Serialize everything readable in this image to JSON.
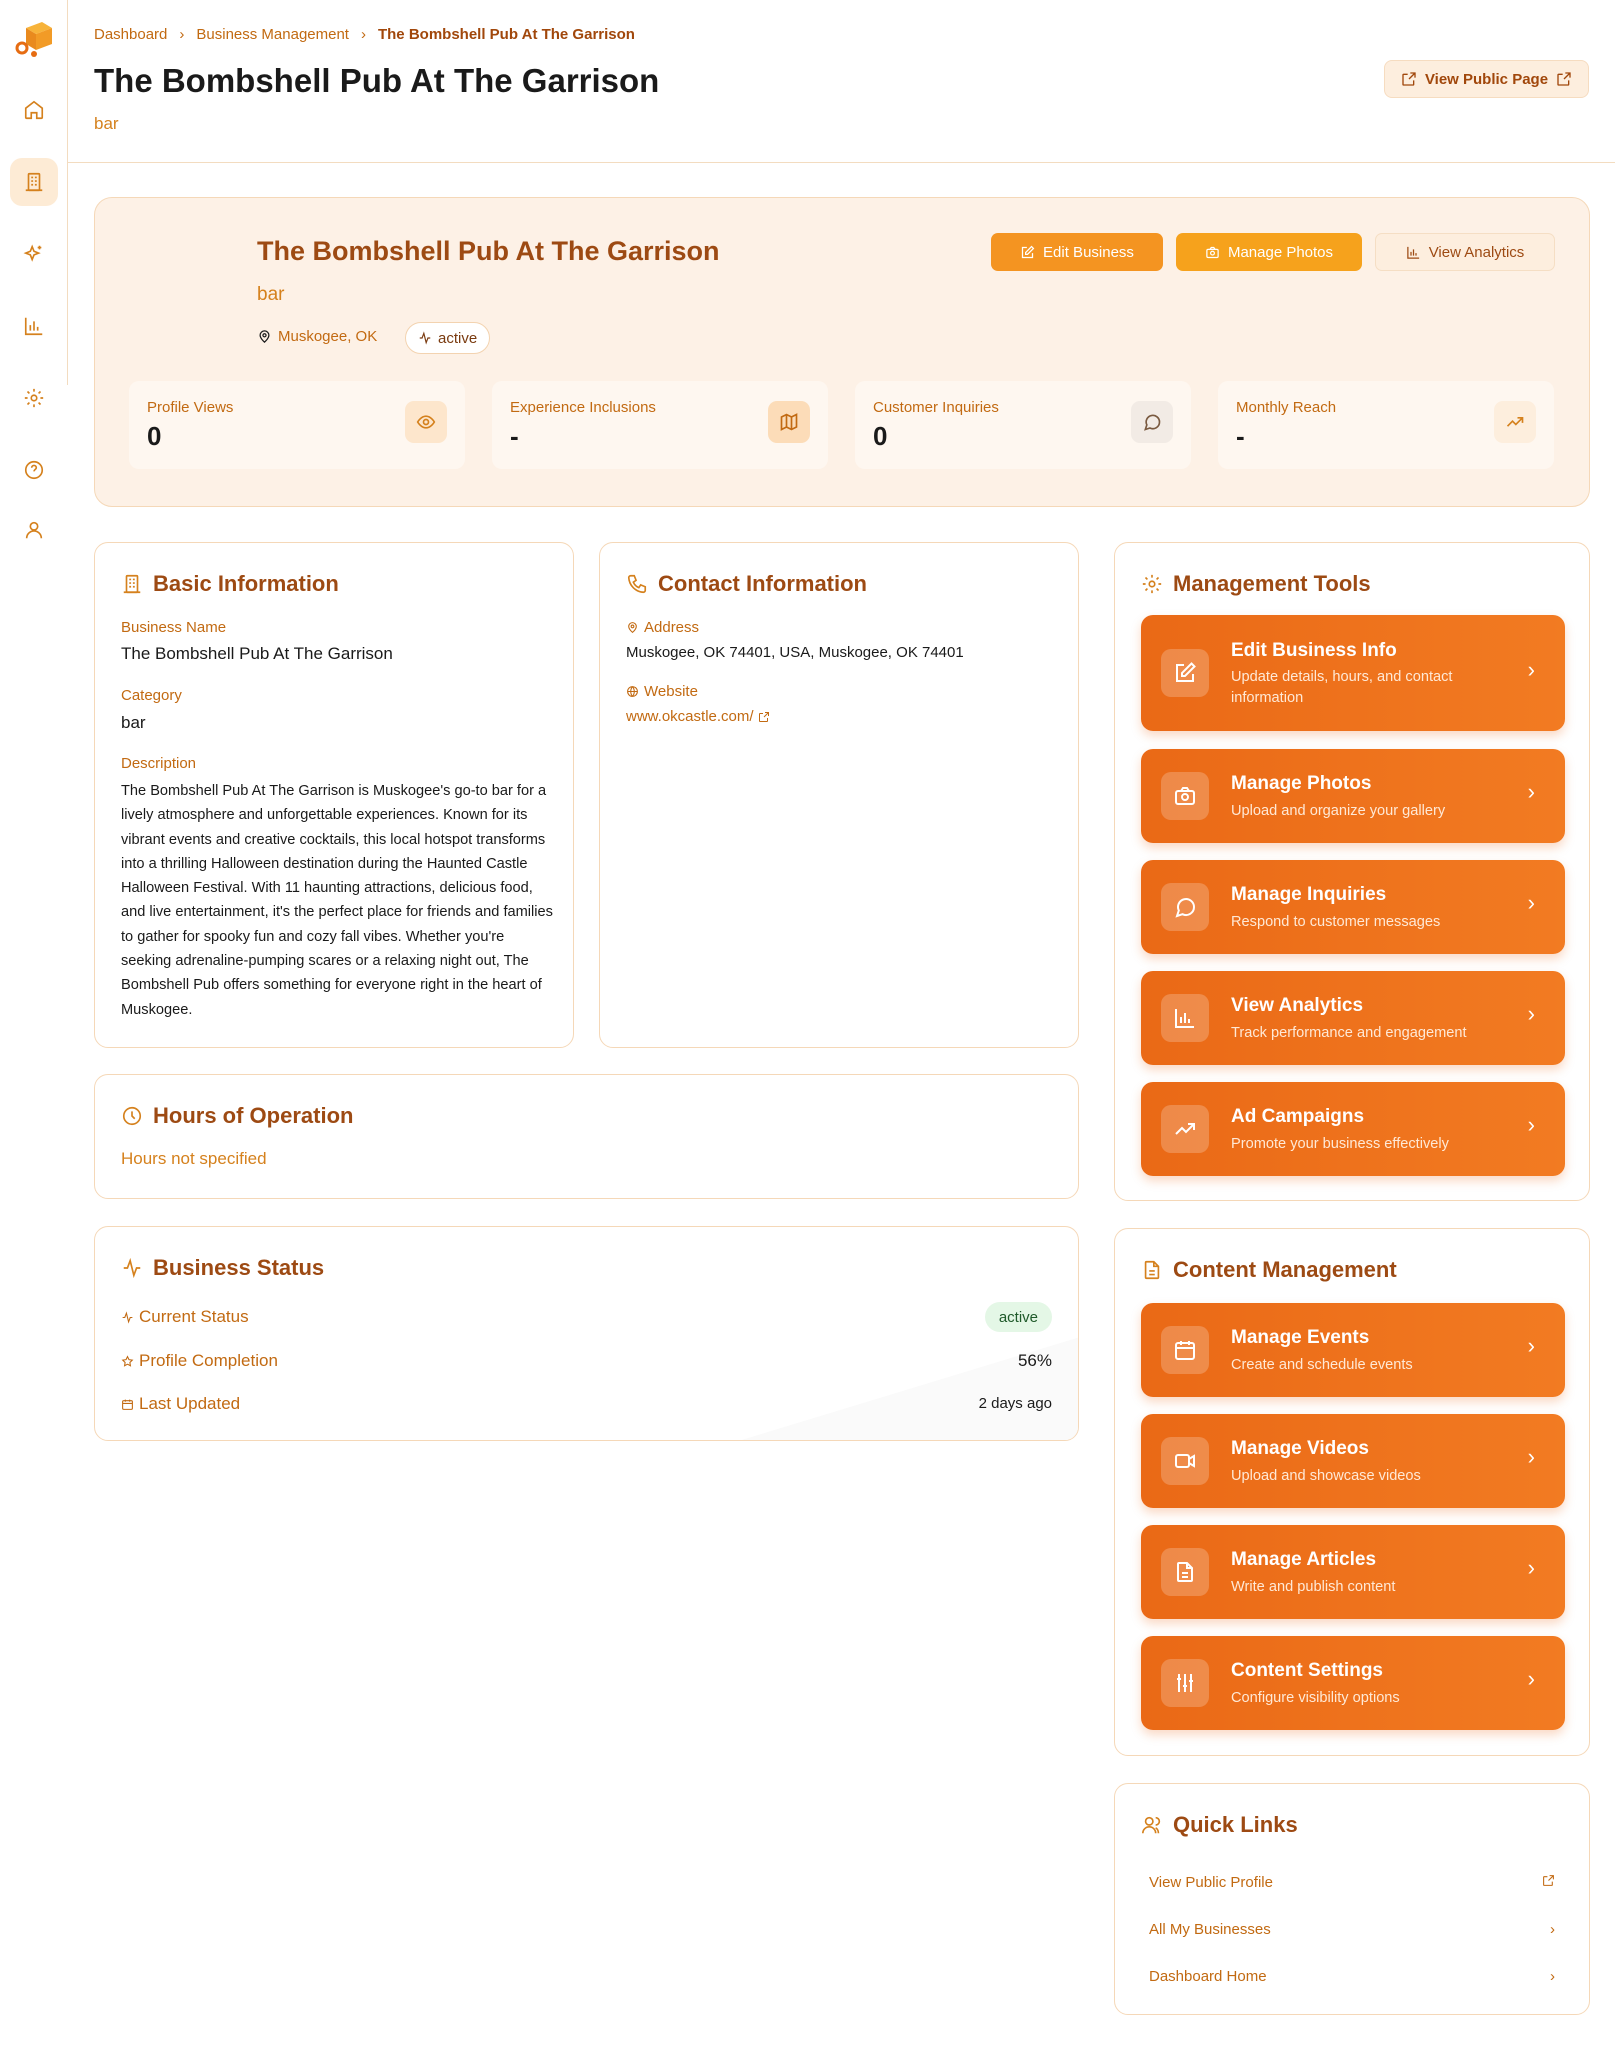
{
  "breadcrumb": [
    "Dashboard",
    "Business Management",
    "The Bombshell Pub At The Garrison"
  ],
  "page": {
    "title": "The Bombshell Pub At The Garrison",
    "subtitle": "bar",
    "public_button": "View Public Page"
  },
  "hero": {
    "name": "The Bombshell Pub At The Garrison",
    "category": "bar",
    "location": "Muskogee, OK",
    "status": "active",
    "buttons": {
      "edit": "Edit Business",
      "photos": "Manage Photos",
      "analytics": "View Analytics"
    },
    "stats": [
      {
        "label": "Profile Views",
        "value": "0",
        "icon": "eye-icon"
      },
      {
        "label": "Experience Inclusions",
        "value": "-",
        "icon": "map-icon"
      },
      {
        "label": "Customer Inquiries",
        "value": "0",
        "icon": "message-circle-icon"
      },
      {
        "label": "Monthly Reach",
        "value": "-",
        "icon": "trending-up-icon"
      }
    ]
  },
  "basic": {
    "title": "Basic Information",
    "name_label": "Business Name",
    "name": "The Bombshell Pub At The Garrison",
    "category_label": "Category",
    "category": "bar",
    "description_label": "Description",
    "description": "The Bombshell Pub At The Garrison is Muskogee's go-to bar for a lively atmosphere and unforgettable experiences. Known for its vibrant events and creative cocktails, this local hotspot transforms into a thrilling Halloween destination during the Haunted Castle Halloween Festival. With 11 haunting attractions, delicious food, and live entertainment, it's the perfect place for friends and families to gather for spooky fun and cozy fall vibes. Whether you're seeking adrenaline-pumping scares or a relaxing night out, The Bombshell Pub offers something for everyone right in the heart of Muskogee."
  },
  "contact": {
    "title": "Contact Information",
    "address_label": "Address",
    "address": "Muskogee, OK 74401, USA, Muskogee, OK 74401",
    "website_label": "Website",
    "website": "www.okcastle.com/"
  },
  "hours": {
    "title": "Hours of Operation",
    "text": "Hours not specified"
  },
  "status": {
    "title": "Business Status",
    "current_label": "Current Status",
    "current": "active",
    "completion_label": "Profile Completion",
    "completion": "56%",
    "updated_label": "Last Updated",
    "updated": "2 days ago"
  },
  "tools": {
    "title": "Management Tools",
    "items": [
      {
        "title": "Edit Business Info",
        "sub": "Update details, hours, and contact information",
        "icon": "edit-icon"
      },
      {
        "title": "Manage Photos",
        "sub": "Upload and organize your gallery",
        "icon": "camera-icon"
      },
      {
        "title": "Manage Inquiries",
        "sub": "Respond to customer messages",
        "icon": "message-circle-icon"
      },
      {
        "title": "View Analytics",
        "sub": "Track performance and engagement",
        "icon": "bar-chart-icon"
      },
      {
        "title": "Ad Campaigns",
        "sub": "Promote your business effectively",
        "icon": "trending-up-icon"
      }
    ]
  },
  "content": {
    "title": "Content Management",
    "items": [
      {
        "title": "Manage Events",
        "sub": "Create and schedule events",
        "icon": "calendar-icon"
      },
      {
        "title": "Manage Videos",
        "sub": "Upload and showcase videos",
        "icon": "video-icon"
      },
      {
        "title": "Manage Articles",
        "sub": "Write and publish content",
        "icon": "file-text-icon"
      },
      {
        "title": "Content Settings",
        "sub": "Configure visibility options",
        "icon": "sliders-icon"
      }
    ]
  },
  "quick": {
    "title": "Quick Links",
    "items": [
      "View Public Profile",
      "All My Businesses",
      "Dashboard Home"
    ]
  },
  "colors": {
    "accent": "#ea6916",
    "title_brown": "#9d4a13",
    "label_orange": "#c26a12",
    "hero_bg": "#fdf1e6"
  }
}
